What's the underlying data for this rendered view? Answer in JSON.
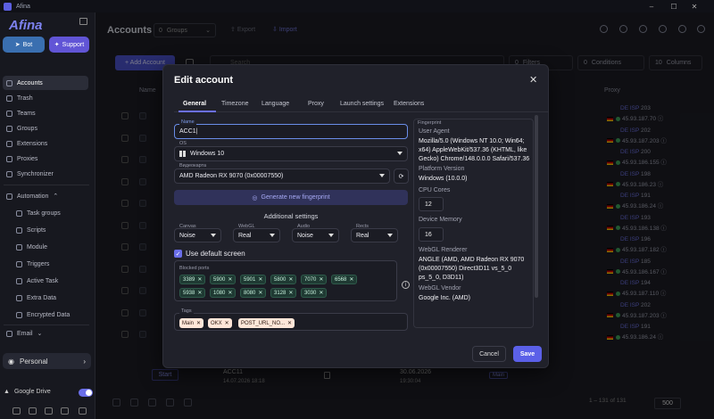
{
  "window": {
    "title": "Afina",
    "minimize": "–",
    "maximize": "☐",
    "close": "✕"
  },
  "sidebar": {
    "logo": "Afina",
    "bot_label": "Bot",
    "support_label": "Support",
    "items": [
      {
        "label": "Accounts"
      },
      {
        "label": "Trash"
      },
      {
        "label": "Teams"
      },
      {
        "label": "Groups"
      },
      {
        "label": "Extensions"
      },
      {
        "label": "Proxies"
      },
      {
        "label": "Synchronizer"
      }
    ],
    "automation": "Automation",
    "automation_items": [
      {
        "label": "Task groups"
      },
      {
        "label": "Scripts"
      },
      {
        "label": "Module"
      },
      {
        "label": "Triggers"
      },
      {
        "label": "Active Task"
      },
      {
        "label": "Extra Data"
      },
      {
        "label": "Encrypted Data"
      }
    ],
    "email": "Email",
    "workspace": "Personal",
    "gdrive": "Google Drive"
  },
  "main": {
    "title": "Accounts",
    "groups_select": "Groups",
    "groups_count": "0",
    "export": "Export",
    "import": "Import",
    "add_account": "+ Add Account",
    "search_placeholder": "Search",
    "filters": "Filters",
    "filters_count": "0",
    "conditions": "Conditions",
    "conditions_count": "0",
    "columns": "Columns",
    "columns_count": "10",
    "col_name": "Name",
    "col_proxy": "Proxy",
    "proxies": [
      {
        "tag": "DE ISP",
        "id": "203",
        "ip": "45.93.187.70"
      },
      {
        "tag": "DE ISP",
        "id": "202",
        "ip": "45.93.187.203"
      },
      {
        "tag": "DE ISP",
        "id": "200",
        "ip": "45.93.186.155"
      },
      {
        "tag": "DE ISP",
        "id": "198",
        "ip": "45.93.186.23"
      },
      {
        "tag": "DE ISP",
        "id": "191",
        "ip": "45.93.186.24"
      },
      {
        "tag": "DE ISP",
        "id": "193",
        "ip": "45.93.186.138"
      },
      {
        "tag": "DE ISP",
        "id": "196",
        "ip": "45.93.187.182"
      },
      {
        "tag": "DE ISP",
        "id": "185",
        "ip": "45.93.186.167"
      },
      {
        "tag": "DE ISP",
        "id": "194",
        "ip": "45.93.187.110"
      },
      {
        "tag": "DE ISP",
        "id": "202",
        "ip": "45.93.187.203"
      },
      {
        "tag": "DE ISP",
        "id": "191",
        "ip": "45.93.186.24"
      }
    ],
    "bg_row": {
      "start": "Start",
      "name": "ACC11",
      "created": "14.07.2026 18:18",
      "expires": "30.06.2026",
      "expires_time": "19:30:04",
      "tag": "Main"
    },
    "pagination": "1 – 131 of 131",
    "page_size": "500"
  },
  "modal": {
    "title": "Edit account",
    "close": "✕",
    "tabs": [
      "General",
      "Timezone",
      "Language",
      "Proxy",
      "Launch settings",
      "Extensions"
    ],
    "name_label": "Name",
    "name_value": "ACC1",
    "os_label": "OS",
    "os_value": "Windows 10",
    "gpu_label": "Видеокарта",
    "gpu_value": "AMD Radeon RX 9070 (0x00007550)",
    "generate": "Generate new fingerprint",
    "additional": "Additional settings",
    "canvas_label": "Canvas",
    "canvas_value": "Noise",
    "webgl_label": "WebGL",
    "webgl_value": "Real",
    "audio_label": "Audio",
    "audio_value": "Noise",
    "rects_label": "Rects",
    "rects_value": "Real",
    "default_screen": "Use default screen",
    "ports_label": "Blocked ports",
    "ports": [
      "3389",
      "5900",
      "5901",
      "5800",
      "7070",
      "6568",
      "5938",
      "1080",
      "8080",
      "3128",
      "3030"
    ],
    "tags_label": "Tags",
    "tags": [
      "Main",
      "OKX",
      "POST_URL_NO..."
    ],
    "fingerprint": {
      "legend": "Fingerprint",
      "ua_label": "User Agent",
      "ua_value": "Mozilla/5.0 (Windows NT 10.0; Win64; x64) AppleWebKit/537.36 (KHTML, like Gecko) Chrome/148.0.0.0 Safari/537.36",
      "platform_label": "Platform Version",
      "platform_value": "Windows (10.0.0)",
      "cpu_label": "CPU Cores",
      "cpu_value": "12",
      "mem_label": "Device Memory",
      "mem_value": "16",
      "renderer_label": "WebGL Renderer",
      "renderer_value": "ANGLE (AMD, AMD Radeon RX 9070 (0x00007550) Direct3D11 vs_5_0 ps_5_0, D3D11)",
      "vendor_label": "WebGL Vendor",
      "vendor_value": "Google Inc. (AMD)"
    },
    "cancel": "Cancel",
    "save": "Save"
  }
}
